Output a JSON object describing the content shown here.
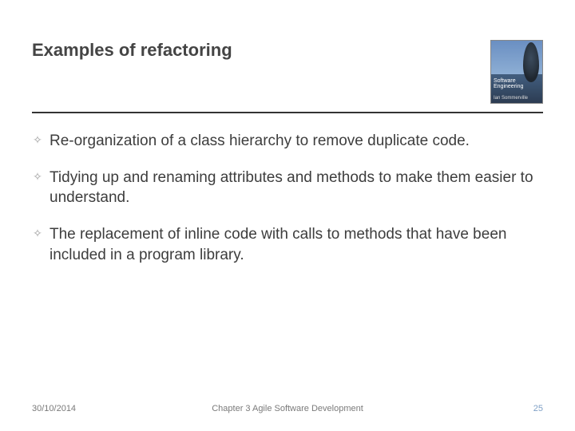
{
  "header": {
    "title": "Examples of refactoring",
    "book": {
      "line1": "Software",
      "line2": "Engineering",
      "author": "Ian Sommerville"
    }
  },
  "bullets": [
    "Re-organization of a class hierarchy to remove duplicate code.",
    "Tidying up and renaming attributes and methods to make them easier to understand.",
    "The replacement of inline code with calls to methods that have been included in a program library."
  ],
  "footer": {
    "date": "30/10/2014",
    "center": "Chapter 3 Agile Software Development",
    "page": "25"
  }
}
